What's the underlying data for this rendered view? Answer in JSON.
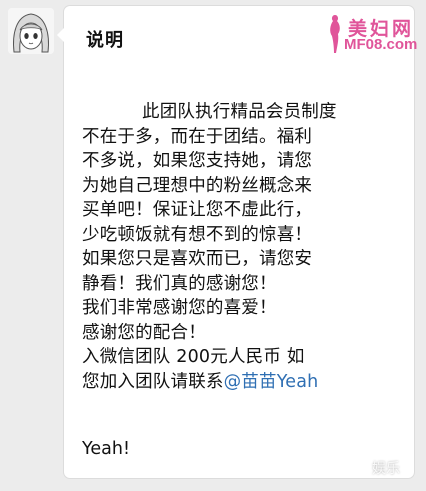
{
  "header": {
    "title": "说明"
  },
  "logo": {
    "brand": "美妇网",
    "url": "MF08.com"
  },
  "message": {
    "lines": [
      "此团队执行精品会员制度",
      "不在于多，而在于团结。福利",
      "不多说，如果您支持她，请您",
      "为她自己理想中的粉丝概念来",
      "买单吧！保证让您不虚此行，",
      "少吃顿饭就有想不到的惊喜！",
      "如果您只是喜欢而已，请您安",
      "静看！我们真的感谢您！",
      "我们非常感谢您的喜爱！",
      "感谢您的配合！",
      "入微信团队 200元人民币  如"
    ],
    "last_line_prefix": "您加入团队请联系",
    "mention": "@苗苗Yeah",
    "closing": "Yeah!"
  },
  "watermark": "娱乐",
  "colors": {
    "logo": "#e0559a",
    "mention": "#2f6fb3",
    "bubble": "#ffffff",
    "background": "#ececec"
  }
}
